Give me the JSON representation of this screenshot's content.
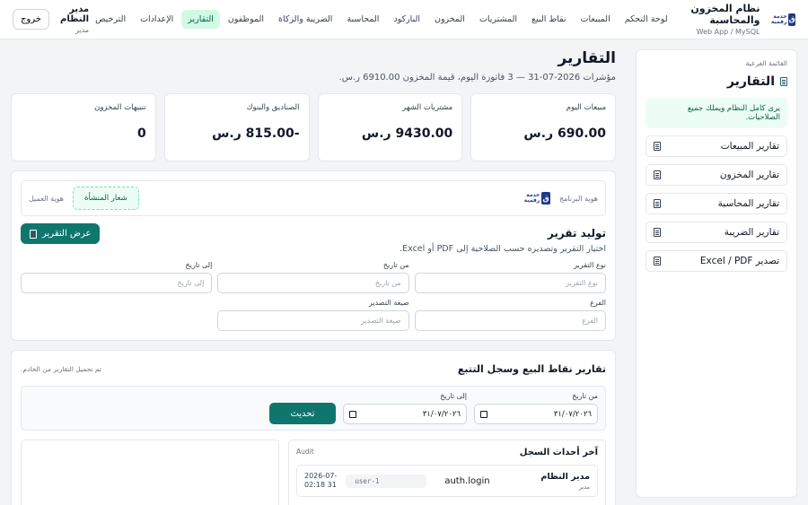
{
  "header": {
    "app_title": "نظام المخزون والمحاسبة",
    "app_subtitle": "Web App / MySQL",
    "logo_text": "خدمة رقمية",
    "nav": [
      "لوحة التحكم",
      "المبيعات",
      "نقاط البيع",
      "المشتريات",
      "المخزون",
      "الباركود",
      "المحاسبة",
      "الضريبة والزكاة",
      "الموظفون",
      "التقارير",
      "الإعدادات",
      "الترخيص"
    ],
    "active_nav": "التقارير",
    "user_name": "مدير النظام",
    "user_role": "مدير",
    "logout_label": "خروج"
  },
  "sidebar": {
    "caption": "القائمة الفرعية",
    "title": "التقارير",
    "note": "يرى كامل النظام ويملك جميع الصلاحيات.",
    "items": [
      "تقارير المبيعات",
      "تقارير المخزون",
      "تقارير المحاسبة",
      "تقارير الضريبة",
      "تصدير Excel / PDF"
    ]
  },
  "page": {
    "title": "التقارير",
    "subtitle": "مؤشرات 2026-07-31 — 3 فاتورة اليوم، قيمة المخزون 6910.00 ر.س."
  },
  "kpis": [
    {
      "label": "مبيعات اليوم",
      "value": "690.00 ر.س"
    },
    {
      "label": "مشتريات الشهر",
      "value": "9430.00 ر.س"
    },
    {
      "label": "الصناديق والبنوك",
      "value": "-815.00 ر.س"
    },
    {
      "label": "تنبيهات المخزون",
      "value": "0"
    }
  ],
  "identity": {
    "program_label": "هوية البرنامج",
    "client_label": "هوية العميل",
    "emblem_label": "شعار المنشأة"
  },
  "generator": {
    "title": "توليد تقرير",
    "subtitle": "اختيار التقرير وتصديره حسب الصلاحية إلى PDF أو Excel.",
    "button": "عرض التقرير",
    "fields": [
      {
        "label": "نوع التقرير",
        "placeholder": "نوع التقرير"
      },
      {
        "label": "من تاريخ",
        "placeholder": "من تاريخ"
      },
      {
        "label": "إلى تاريخ",
        "placeholder": "إلى تاريخ"
      },
      {
        "label": "الفرع",
        "placeholder": "الفرع"
      },
      {
        "label": "صيغة التصدير",
        "placeholder": "صيغة التصدير"
      }
    ]
  },
  "pos": {
    "title": "تقارير نقاط البيع وسجل التتبع",
    "status": "تم تحميل التقارير من الخادم.",
    "from_label": "من تاريخ",
    "from_value": "٣١/٠٧/٢٠٢٦",
    "to_label": "إلى تاريخ",
    "to_value": "٣١/٠٧/٢٠٢٦",
    "update_button": "تحديث",
    "log_title": "آخر أحداث السجل",
    "log_tag": "Audit",
    "log_rows": [
      {
        "user": "مدير النظام",
        "role": "مدير",
        "action": "auth.login",
        "uid": "user-1",
        "time_date": "2026-07-",
        "time_clock": "02:18 31"
      }
    ]
  }
}
